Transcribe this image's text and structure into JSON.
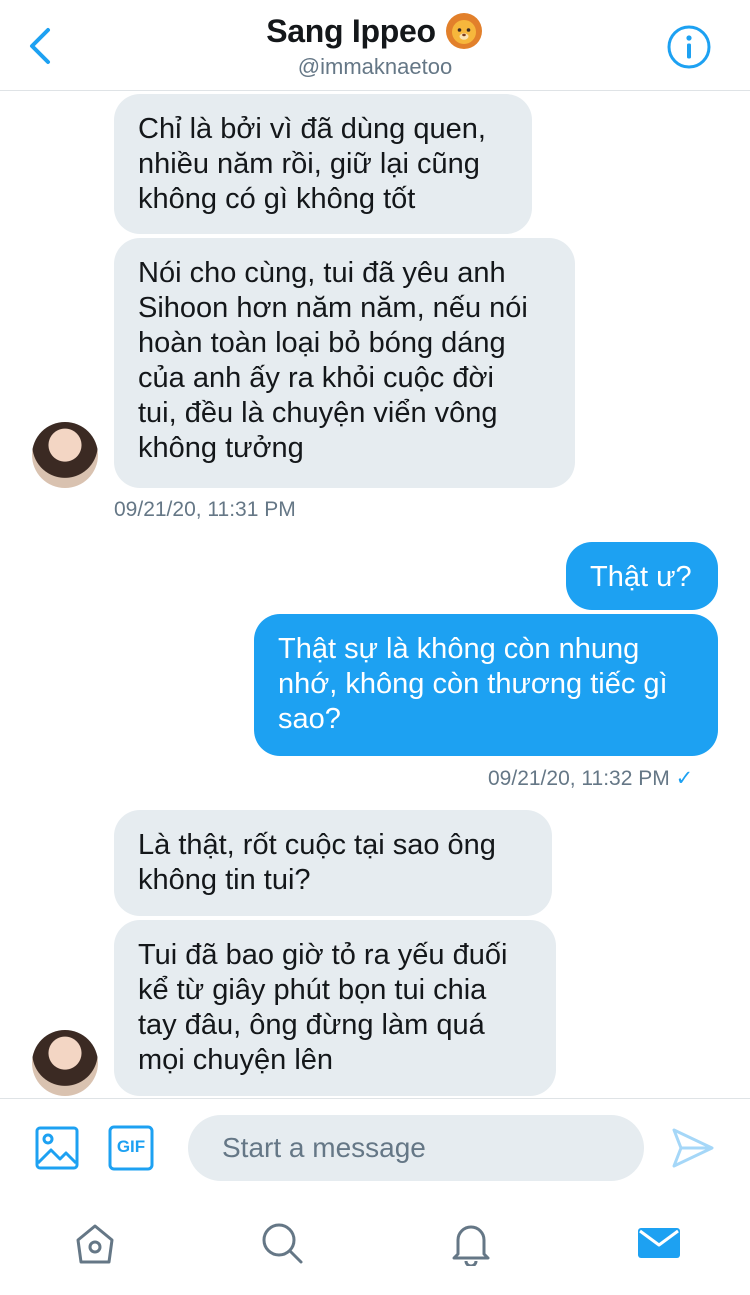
{
  "header": {
    "name": "Sang Ippeo",
    "handle": "@immaknaetoo",
    "back_icon": "chevron-left-icon",
    "info_icon": "info-icon"
  },
  "messages": [
    {
      "side": "in",
      "text": "Chỉ là bởi vì đã dùng quen,\nnhiều năm rồi, giữ lại cũng\nkhông có gì không tốt"
    },
    {
      "side": "in",
      "text": "Nói cho cùng, tui đã yêu anh\nSihoon hơn năm năm, nếu nói\nhoàn toàn loại bỏ bóng dáng\ncủa anh ấy ra khỏi cuộc đời\ntui, đều là chuyện viển vông\nkhông tưởng"
    },
    {
      "side": "out",
      "text": "Thật ư?"
    },
    {
      "side": "out",
      "text": "Thật sự là không còn nhung\nnhớ, không còn thương tiếc gì\nsao?"
    },
    {
      "side": "in",
      "text": "Là thật, rốt cuộc tại sao ông\nkhông tin tui?"
    },
    {
      "side": "in",
      "text": "Tui đã bao giờ tỏ ra yếu đuối\nkể từ giây phút bọn tui chia\ntay đâu, ông đừng làm quá\nmọi chuyện lên"
    }
  ],
  "timestamps": {
    "first": "09/21/20, 11:31 PM",
    "second": "09/21/20, 11:32 PM",
    "read_mark": "✓"
  },
  "composer": {
    "placeholder": "Start a message",
    "gif_label": "GIF"
  },
  "colors": {
    "accent": "#1da1f2",
    "incoming_bubble": "#e6ecf0",
    "muted_text": "#657786"
  }
}
